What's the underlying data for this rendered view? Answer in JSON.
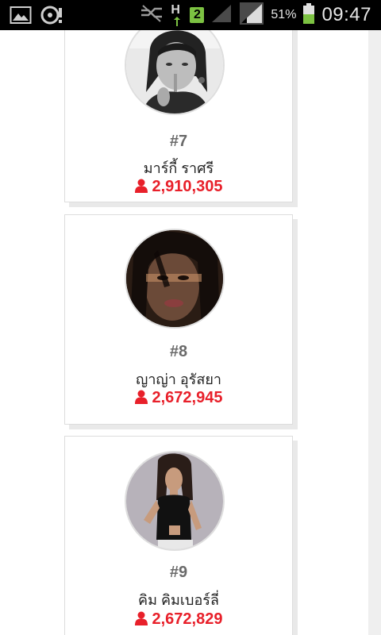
{
  "status_bar": {
    "network_type": "H",
    "notification_count": "2",
    "battery_percent": "51%",
    "time": "09:47",
    "icons": [
      "gallery-icon",
      "sync-icon",
      "signal-muted-icon",
      "network-h-icon",
      "notification-count-badge",
      "cell-signal-icon",
      "wifi-signal-icon",
      "battery-icon"
    ]
  },
  "colors": {
    "accent": "#e8202a",
    "rank": "#6a6a6a",
    "battery": "#7cc242"
  },
  "cards": [
    {
      "rank": "#7",
      "name": "มาร์กี้ ราศรี",
      "votes": "2,910,305"
    },
    {
      "rank": "#8",
      "name": "ญาญ่า อุรัสยา",
      "votes": "2,672,945"
    },
    {
      "rank": "#9",
      "name": "คิม คิมเบอร์ลี่",
      "votes": "2,672,829"
    }
  ]
}
